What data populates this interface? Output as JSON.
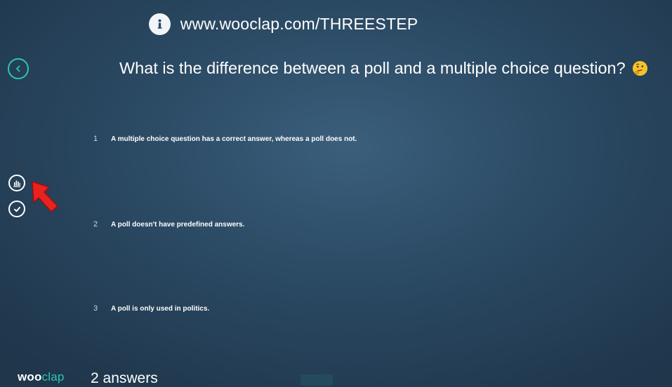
{
  "header": {
    "url": "www.wooclap.com/THREESTEP",
    "info_icon": "info-icon"
  },
  "question": {
    "text": "What is the difference between a poll and a multiple choice question?",
    "emoji_icon": "thinking-face-emoji"
  },
  "choices": [
    {
      "number": "1",
      "text": "A multiple choice question has a correct answer, whereas a poll does not."
    },
    {
      "number": "2",
      "text": "A poll doesn't have predefined answers."
    },
    {
      "number": "3",
      "text": "A poll is only used in politics."
    }
  ],
  "sidebar": {
    "back_icon": "chevron-left-icon",
    "results_icon": "bar-chart-icon",
    "correct_icon": "checkmark-icon",
    "annotation_icon": "red-arrow-icon"
  },
  "footer": {
    "brand_part1": "woo",
    "brand_part2": "clap",
    "answers": "2 answers"
  },
  "colors": {
    "accent": "#2ec7b0",
    "background": "#2b4a64",
    "arrow": "#e8231f"
  }
}
